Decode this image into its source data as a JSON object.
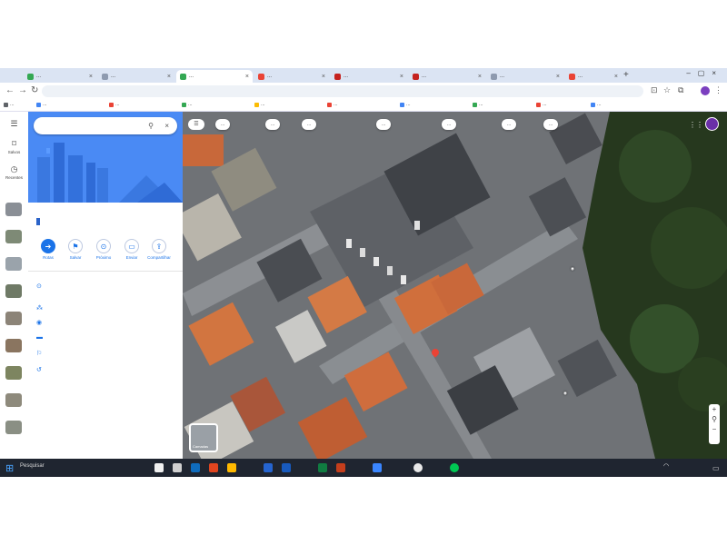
{
  "browser": {
    "tabs": [
      {
        "label": "...",
        "color": "#34a853",
        "active": false
      },
      {
        "label": "...",
        "color": "#8e9aaf",
        "active": false
      },
      {
        "label": "...",
        "color": "#34a853",
        "active": true
      },
      {
        "label": "...",
        "color": "#ea4335",
        "active": false
      },
      {
        "label": "...",
        "color": "#c5221f",
        "active": false
      },
      {
        "label": "...",
        "color": "#c5221f",
        "active": false
      },
      {
        "label": "...",
        "color": "#8e9aaf",
        "active": false
      },
      {
        "label": "...",
        "color": "#ea4335",
        "active": false
      }
    ],
    "new_tab": "+",
    "address": "",
    "bookmarks": [
      {
        "label": "...",
        "color": "#5f6368"
      },
      {
        "label": "...",
        "color": "#4285f4"
      },
      {
        "label": "...",
        "color": "#ea4335"
      },
      {
        "label": "...",
        "color": "#34a853"
      },
      {
        "label": "...",
        "color": "#fbbc04"
      },
      {
        "label": "...",
        "color": "#ea4335"
      },
      {
        "label": "...",
        "color": "#4285f4"
      },
      {
        "label": "...",
        "color": "#34a853"
      },
      {
        "label": "...",
        "color": "#ea4335"
      },
      {
        "label": "...",
        "color": "#4285f4"
      }
    ]
  },
  "maps": {
    "rail": [
      {
        "icon": "menu-icon",
        "glyph": "☰",
        "label": ""
      },
      {
        "icon": "saved-icon",
        "glyph": "⌑",
        "label": "Salvos"
      },
      {
        "icon": "recents-icon",
        "glyph": "◷",
        "label": "Recentes"
      }
    ],
    "search_value": "",
    "place": {
      "title": "",
      "subtitle": ""
    },
    "actions": [
      {
        "label": "Rotas",
        "glyph": "➔",
        "primary": true
      },
      {
        "label": "Salvar",
        "glyph": "⚑",
        "primary": false
      },
      {
        "label": "Próximo",
        "glyph": "⊙",
        "primary": false
      },
      {
        "label": "Enviar",
        "glyph": "▭",
        "primary": false
      },
      {
        "label": "Compartilhar",
        "glyph": "⇪",
        "primary": false
      }
    ],
    "info": [
      {
        "icon": "location-pin-icon",
        "glyph": "⊙",
        "text": ""
      },
      {
        "icon": "plus-code-icon",
        "glyph": "⁂",
        "text": ""
      },
      {
        "icon": "place-icon",
        "glyph": "◉",
        "text": ""
      },
      {
        "icon": "business-icon",
        "glyph": "▬",
        "text": ""
      },
      {
        "icon": "label-icon",
        "glyph": "⚐",
        "text": ""
      },
      {
        "icon": "history-icon",
        "glyph": "↺",
        "text": ""
      }
    ],
    "chips": [
      "...",
      "...",
      "...",
      "...",
      "...",
      "...",
      "..."
    ],
    "layers_label": "Camadas",
    "pin_color": "#ea4335",
    "accent_color": "#1a73e8"
  },
  "taskbar": {
    "search_placeholder": "Pesquisar",
    "apps": [
      "#f0f0f0",
      "#d0d0d0",
      "#0f6cbd",
      "#e1451f",
      "#ffb900",
      "#2564cf",
      "#185abd",
      "#107c41",
      "#c43e1c",
      "#3a86ff",
      "#e8e8e8",
      "#00c853"
    ],
    "time": "",
    "date": ""
  }
}
